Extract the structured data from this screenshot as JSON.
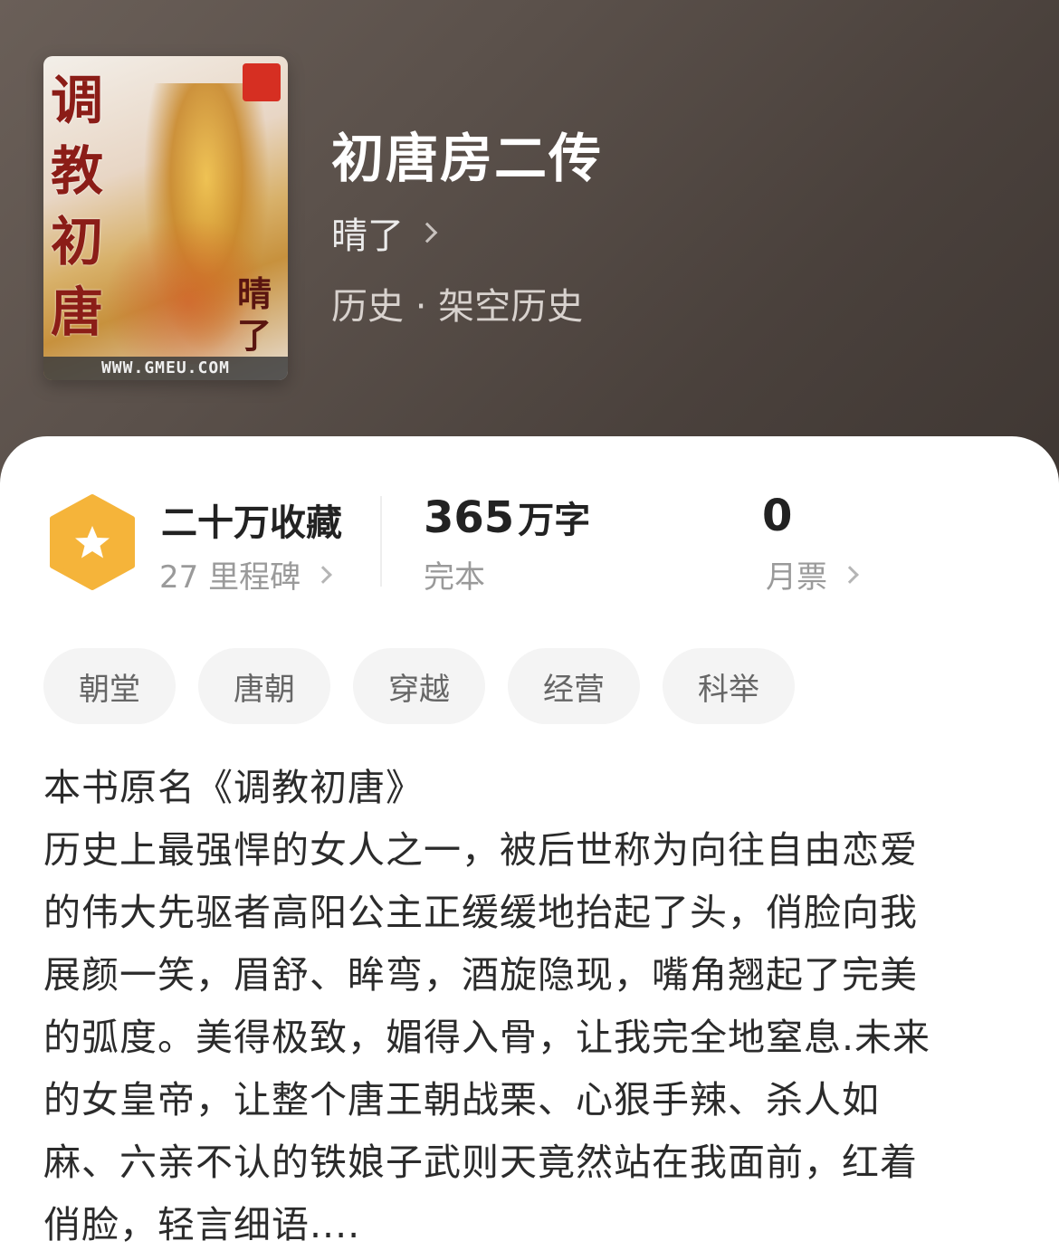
{
  "book": {
    "title": "初唐房二传",
    "author": "晴了",
    "category": "历史 · 架空历史",
    "cover": {
      "calligraphy": [
        "调",
        "教",
        "初",
        "唐"
      ],
      "signature": [
        "晴",
        "了"
      ],
      "url_text": "WWW.GMEU.COM"
    }
  },
  "stats": {
    "collections_label": "二十万收藏",
    "milestones_label": "27 里程碑",
    "word_count_number": "365",
    "word_count_unit": "万字",
    "status_label": "完本",
    "monthly_votes_value": "0",
    "monthly_votes_label": "月票"
  },
  "tags": [
    "朝堂",
    "唐朝",
    "穿越",
    "经营",
    "科举"
  ],
  "description_lines": [
    "本书原名《调教初唐》",
    "历史上最强悍的女人之一，被后世称为向往自由恋爱",
    "的伟大先驱者高阳公主正缓缓地抬起了头，俏脸向我",
    "展颜一笑，眉舒、眸弯，酒旋隐现，嘴角翘起了完美",
    "的弧度。美得极致，媚得入骨，让我完全地窒息.未来",
    "的女皇帝，让整个唐王朝战栗、心狠手辣、杀人如",
    "麻、六亲不认的铁娘子武则天竟然站在我面前，红着",
    "俏脸，轻言细语...."
  ],
  "colors": {
    "hero_background": "#5b514b",
    "milestone_badge": "#f5b43a",
    "tag_background": "#f4f4f4",
    "text_primary": "#222222",
    "text_secondary": "#9a9a9a"
  },
  "icons": {
    "badge": "hexagon-star-icon",
    "author_more": "chevron-right-icon",
    "milestones_more": "chevron-right-icon",
    "votes_more": "chevron-right-icon"
  }
}
